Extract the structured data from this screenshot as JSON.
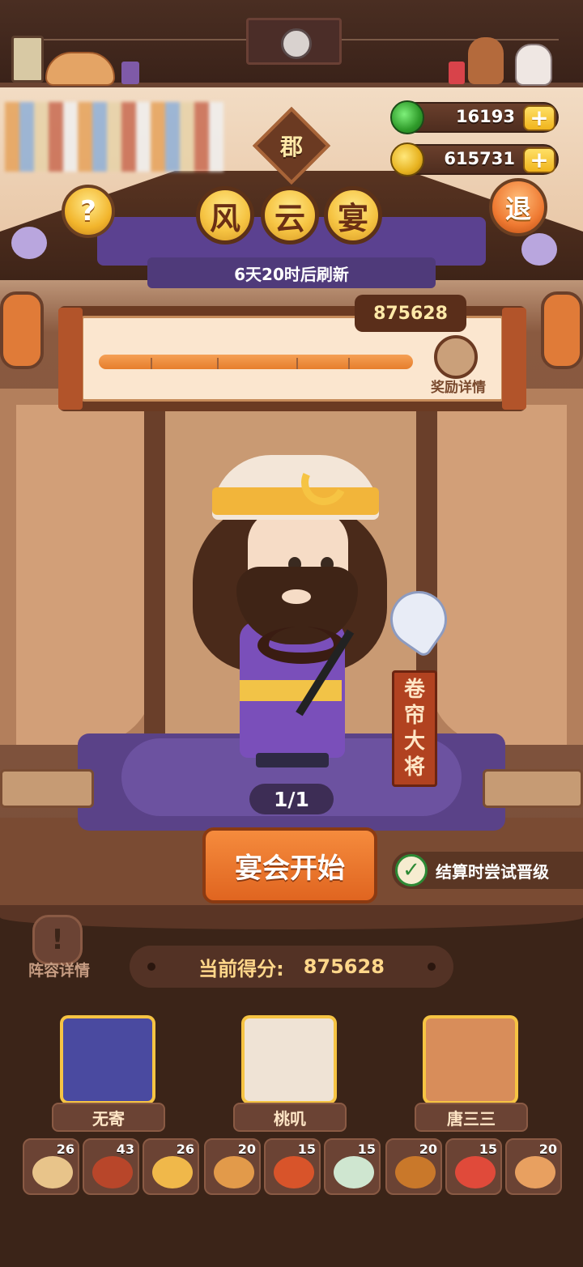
{
  "currency": {
    "jade": {
      "icon": "jade-coin-icon",
      "value": "16193",
      "plus": "+"
    },
    "gold": {
      "icon": "gold-coin-icon",
      "value": "615731",
      "plus": "+"
    }
  },
  "header": {
    "help": "?",
    "exit": "退",
    "badge": "郡",
    "title_chars": [
      "风",
      "云",
      "宴"
    ],
    "refresh": "6天20时后刷新"
  },
  "progress": {
    "score": "875628",
    "fill_fraction": 1.0,
    "reward_label": "奖励详情"
  },
  "character": {
    "name_chars": [
      "卷",
      "帘",
      "大",
      "将"
    ],
    "counter": "1/1"
  },
  "actions": {
    "start": "宴会开始",
    "promo_checked": "✓",
    "promo_label": "结算时尝试晋级",
    "lineup_label": "阵容详情",
    "lineup_icon": "!"
  },
  "score": {
    "label": "当前得分:",
    "value": "875628"
  },
  "heroes": [
    {
      "name": "无寄",
      "color": "#4a4aa0"
    },
    {
      "name": "桃叽",
      "color": "#efe3d5"
    },
    {
      "name": "唐三三",
      "color": "#d88d5a"
    }
  ],
  "dishes": [
    {
      "count": "26",
      "color": "#e8c48a"
    },
    {
      "count": "43",
      "color": "#b8462a"
    },
    {
      "count": "26",
      "color": "#f0b84a"
    },
    {
      "count": "20",
      "color": "#e29a4a"
    },
    {
      "count": "15",
      "color": "#d8542a"
    },
    {
      "count": "15",
      "color": "#cfe6d0"
    },
    {
      "count": "20",
      "color": "#c9782a"
    },
    {
      "count": "15",
      "color": "#e04a3a"
    },
    {
      "count": "20",
      "color": "#e8a060"
    }
  ]
}
